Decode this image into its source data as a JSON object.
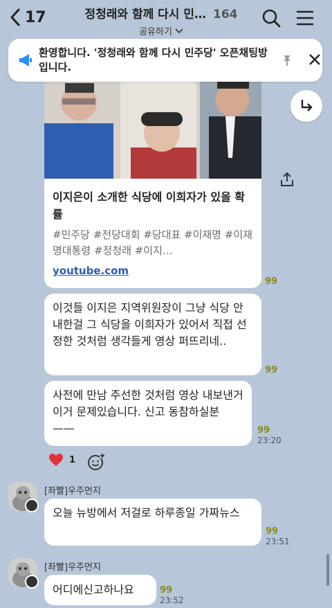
{
  "header": {
    "back_count": "17",
    "title": "정청래와 함께 다시 민…",
    "member_count": "164",
    "share_label": "공유하기"
  },
  "notice": {
    "text": "환영합니다. '정청래와 함께 다시 민주당' 오픈채팅방입니다."
  },
  "link_card": {
    "title": "이지은이 소개한 식당에 이희자가 있을 확률",
    "tags": "#민주당 #전당대회 #당대표 #이재명 #이재명대통령 #정청래 #이지…",
    "domain": "youtube.com",
    "read_count": "99"
  },
  "messages": [
    {
      "text": "이것들 이지은 지역위원장이 그냥 식당 안내한걸 그 식당을 이희자가 있어서 직접 선정한 것처럼 생각들게 영상 퍼뜨리네..",
      "read_count": "99",
      "time": ""
    },
    {
      "text": "사전에 만남 주선한 것처럼 영상 내보낸거 이거 문제있습니다. 신고 동참하실분 ——",
      "read_count": "99",
      "time": "23:20"
    }
  ],
  "reactions": {
    "heart_count": "1"
  },
  "incoming": [
    {
      "sender": "[좌빨]우주먼지",
      "text": "오늘 뉴방에서 저걸로 하루종일 가짜뉴스",
      "read_count": "99",
      "time": "23:51"
    },
    {
      "sender": "[좌빨]우주먼지",
      "text": "어디에신고하나요",
      "read_count": "99",
      "time": "23:52"
    }
  ],
  "colors": {
    "background": "#b7c7d9",
    "bubble": "#ffffff",
    "link": "#2f5bb3",
    "heart": "#e0323c",
    "notice_icon": "#2d8cf0"
  }
}
